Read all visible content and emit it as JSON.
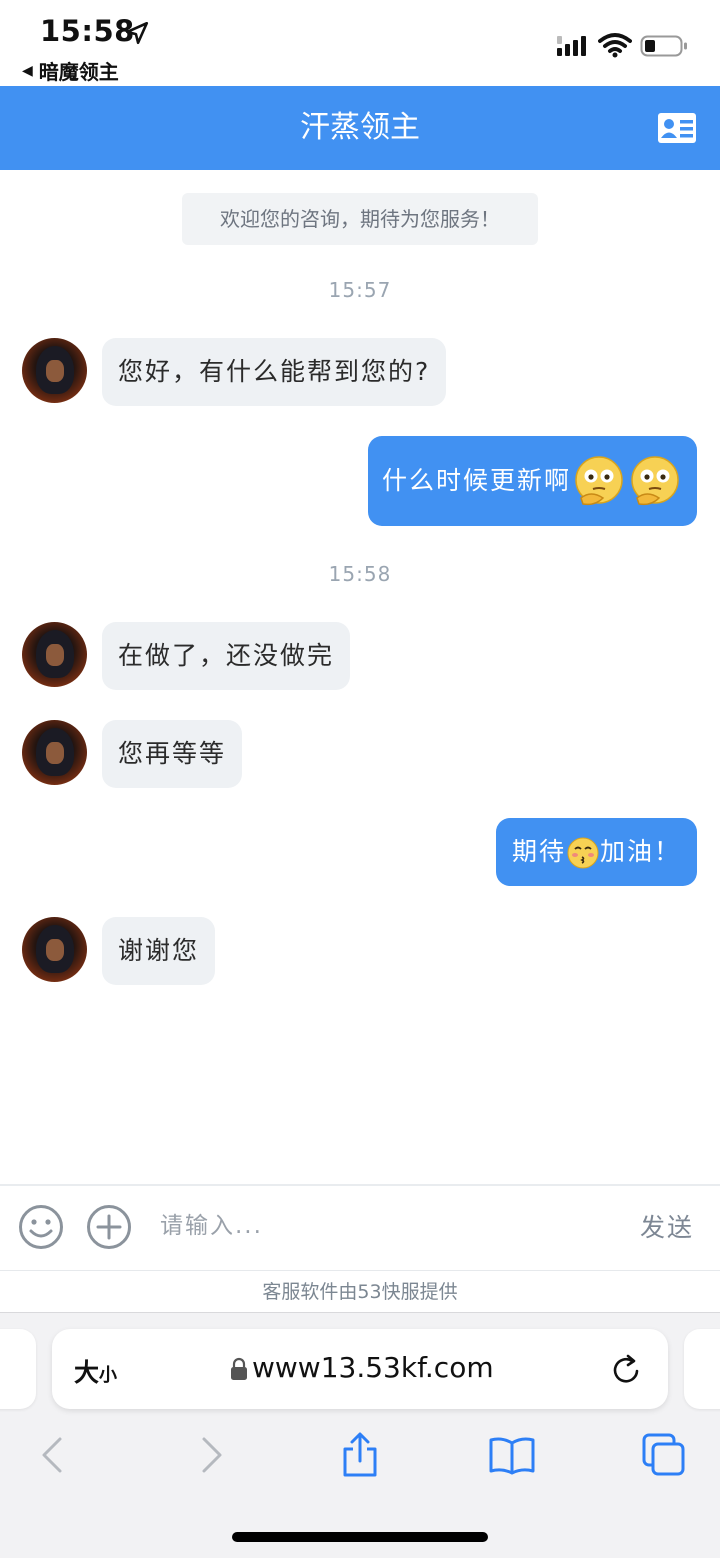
{
  "status_bar": {
    "time": "15:58",
    "back_app": "暗魔领主",
    "battery_level": 0.3
  },
  "header": {
    "title": "汗蒸领主",
    "card_icon": "contact-card-icon"
  },
  "welcome_text": "欢迎您的咨询，期待为您服务！",
  "messages": [
    {
      "type": "time",
      "text": "15:57"
    },
    {
      "type": "incoming",
      "text": "您好，有什么能帮到您的?"
    },
    {
      "type": "outgoing",
      "text": "什么时候更新啊",
      "emojis": [
        "thinking-face-emoji",
        "thinking-face-emoji"
      ]
    },
    {
      "type": "time",
      "text": "15:58"
    },
    {
      "type": "incoming",
      "text": "在做了，还没做完"
    },
    {
      "type": "incoming",
      "text": "您再等等"
    },
    {
      "type": "outgoing",
      "text_before": "期待",
      "emoji": "kissing-face-emoji",
      "text_after": "加油！"
    },
    {
      "type": "incoming",
      "text": "谢谢您"
    }
  ],
  "input_bar": {
    "placeholder": "请输入...",
    "send_label": "发送",
    "emoji_icon": "smiley-icon",
    "plus_icon": "plus-circle-icon"
  },
  "provider_text": "客服软件由53快服提供",
  "safari": {
    "text_size_big": "大",
    "text_size_small": "小",
    "url": "www13.53kf.com",
    "nav_icons": [
      "back-arrow-icon",
      "forward-arrow-icon",
      "share-icon",
      "bookmarks-icon",
      "tabs-icon"
    ]
  },
  "colors": {
    "brand_blue": "#4191f2",
    "incoming_bubble": "#eef1f4",
    "timestamp": "#9aa5b1"
  }
}
